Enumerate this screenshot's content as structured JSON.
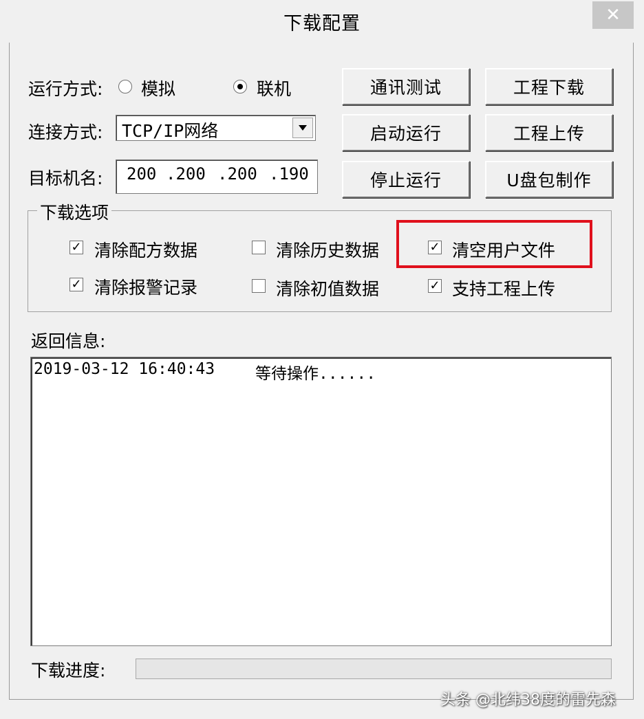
{
  "window": {
    "title": "下载配置",
    "close_glyph": "✕"
  },
  "run_mode": {
    "label": "运行方式:",
    "options": [
      {
        "label": "模拟",
        "checked": false
      },
      {
        "label": "联机",
        "checked": true
      }
    ]
  },
  "connection": {
    "label": "连接方式:",
    "value": "TCP/IP网络",
    "dropdown_glyph": "▼"
  },
  "target": {
    "label": "目标机名:",
    "ip_parts": [
      "200",
      ".200",
      ".200",
      ".190"
    ]
  },
  "buttons": {
    "comm_test": "通讯测试",
    "project_download": "工程下载",
    "start_run": "启动运行",
    "project_upload": "工程上传",
    "stop_run": "停止运行",
    "usb_package": "U盘包制作"
  },
  "download_options": {
    "title": "下载选项",
    "items": [
      {
        "label": "清除配方数据",
        "checked": true
      },
      {
        "label": "清除历史数据",
        "checked": false
      },
      {
        "label": "清空用户文件",
        "checked": true
      },
      {
        "label": "清除报警记录",
        "checked": true
      },
      {
        "label": "清除初值数据",
        "checked": false
      },
      {
        "label": "支持工程上传",
        "checked": true
      }
    ]
  },
  "log": {
    "label": "返回信息:",
    "entries": [
      {
        "time": "2019-03-12 16:40:43",
        "message": "等待操作......"
      }
    ]
  },
  "progress": {
    "label": "下载进度:",
    "value": 0
  },
  "watermark": "头条 @北纬38度的雷先森"
}
